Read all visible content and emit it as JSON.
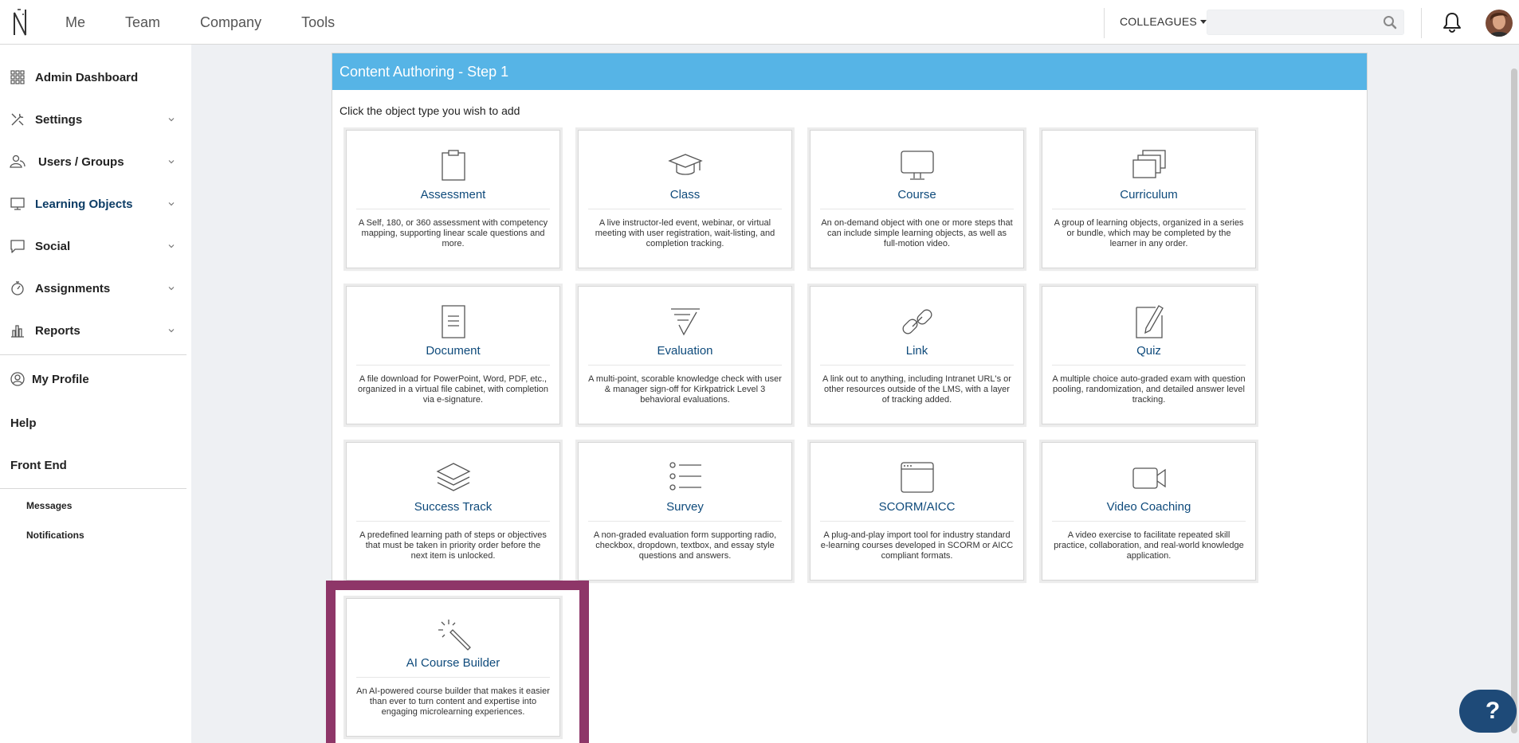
{
  "topbar": {
    "nav": [
      "Me",
      "Team",
      "Company",
      "Tools"
    ],
    "colleagues_label": "COLLEAGUES",
    "search_placeholder": ""
  },
  "sidebar": {
    "items": [
      {
        "label": "Admin Dashboard",
        "icon": "grid-icon",
        "expandable": false
      },
      {
        "label": "Settings",
        "icon": "tools-icon",
        "expandable": true
      },
      {
        "label": "Users / Groups",
        "icon": "users-icon",
        "expandable": true
      },
      {
        "label": "Learning Objects",
        "icon": "monitor-icon",
        "expandable": true,
        "active": true
      },
      {
        "label": "Social",
        "icon": "chat-icon",
        "expandable": true
      },
      {
        "label": "Assignments",
        "icon": "stopwatch-icon",
        "expandable": true
      },
      {
        "label": "Reports",
        "icon": "bar-chart-icon",
        "expandable": true
      }
    ],
    "my_profile": "My Profile",
    "help": "Help",
    "front_end": "Front End",
    "messages": "Messages",
    "notifications": "Notifications"
  },
  "main": {
    "header": "Content Authoring - Step 1",
    "instruction": "Click the object type you wish to add",
    "cards": [
      {
        "title": "Assessment",
        "icon": "clipboard-icon",
        "desc": "A Self, 180, or 360 assessment with competency mapping, supporting linear scale questions and more."
      },
      {
        "title": "Class",
        "icon": "graduation-cap-icon",
        "desc": "A live instructor-led event, webinar, or virtual meeting with user registration, wait-listing, and completion tracking."
      },
      {
        "title": "Course",
        "icon": "monitor-icon",
        "desc": "An on-demand object with one or more steps that can include simple learning objects, as well as full-motion video."
      },
      {
        "title": "Curriculum",
        "icon": "stacked-windows-icon",
        "desc": "A group of learning objects, organized in a series or bundle, which may be completed by the learner in any order."
      },
      {
        "title": "Document",
        "icon": "document-icon",
        "desc": "A file download for PowerPoint, Word, PDF, etc., organized in a virtual file cabinet, with completion via e-signature."
      },
      {
        "title": "Evaluation",
        "icon": "checklist-icon",
        "desc": "A multi-point, scorable knowledge check with user & manager sign-off for Kirkpatrick Level 3 behavioral evaluations."
      },
      {
        "title": "Link",
        "icon": "link-icon",
        "desc": "A link out to anything, including Intranet URL's or other resources outside of the LMS, with a layer of tracking added."
      },
      {
        "title": "Quiz",
        "icon": "pencil-paper-icon",
        "desc": "A multiple choice auto-graded exam with question pooling, randomization, and detailed answer level tracking."
      },
      {
        "title": "Success Track",
        "icon": "layers-icon",
        "desc": "A predefined learning path of steps or objectives that must be taken in priority order before the next item is unlocked."
      },
      {
        "title": "Survey",
        "icon": "list-icon",
        "desc": "A non-graded evaluation form supporting radio, checkbox, dropdown, textbox, and essay style questions and answers."
      },
      {
        "title": "SCORM/AICC",
        "icon": "browser-window-icon",
        "desc": "A plug-and-play import tool for industry standard e-learning courses developed in SCORM or AICC compliant formats."
      },
      {
        "title": "Video Coaching",
        "icon": "video-camera-icon",
        "desc": "A video exercise to facilitate repeated skill practice, collaboration, and real-world knowledge application."
      },
      {
        "title": "AI Course Builder",
        "icon": "magic-wand-icon",
        "desc": "An AI-powered course builder that makes it easier than ever to turn content and expertise into engaging microlearning experiences.",
        "highlighted": true
      }
    ]
  },
  "help_button": "?",
  "colors": {
    "header_blue": "#56b4e6",
    "title_blue": "#0e4a7b",
    "highlight": "#8e3668",
    "help_bg": "#1e4a78"
  }
}
